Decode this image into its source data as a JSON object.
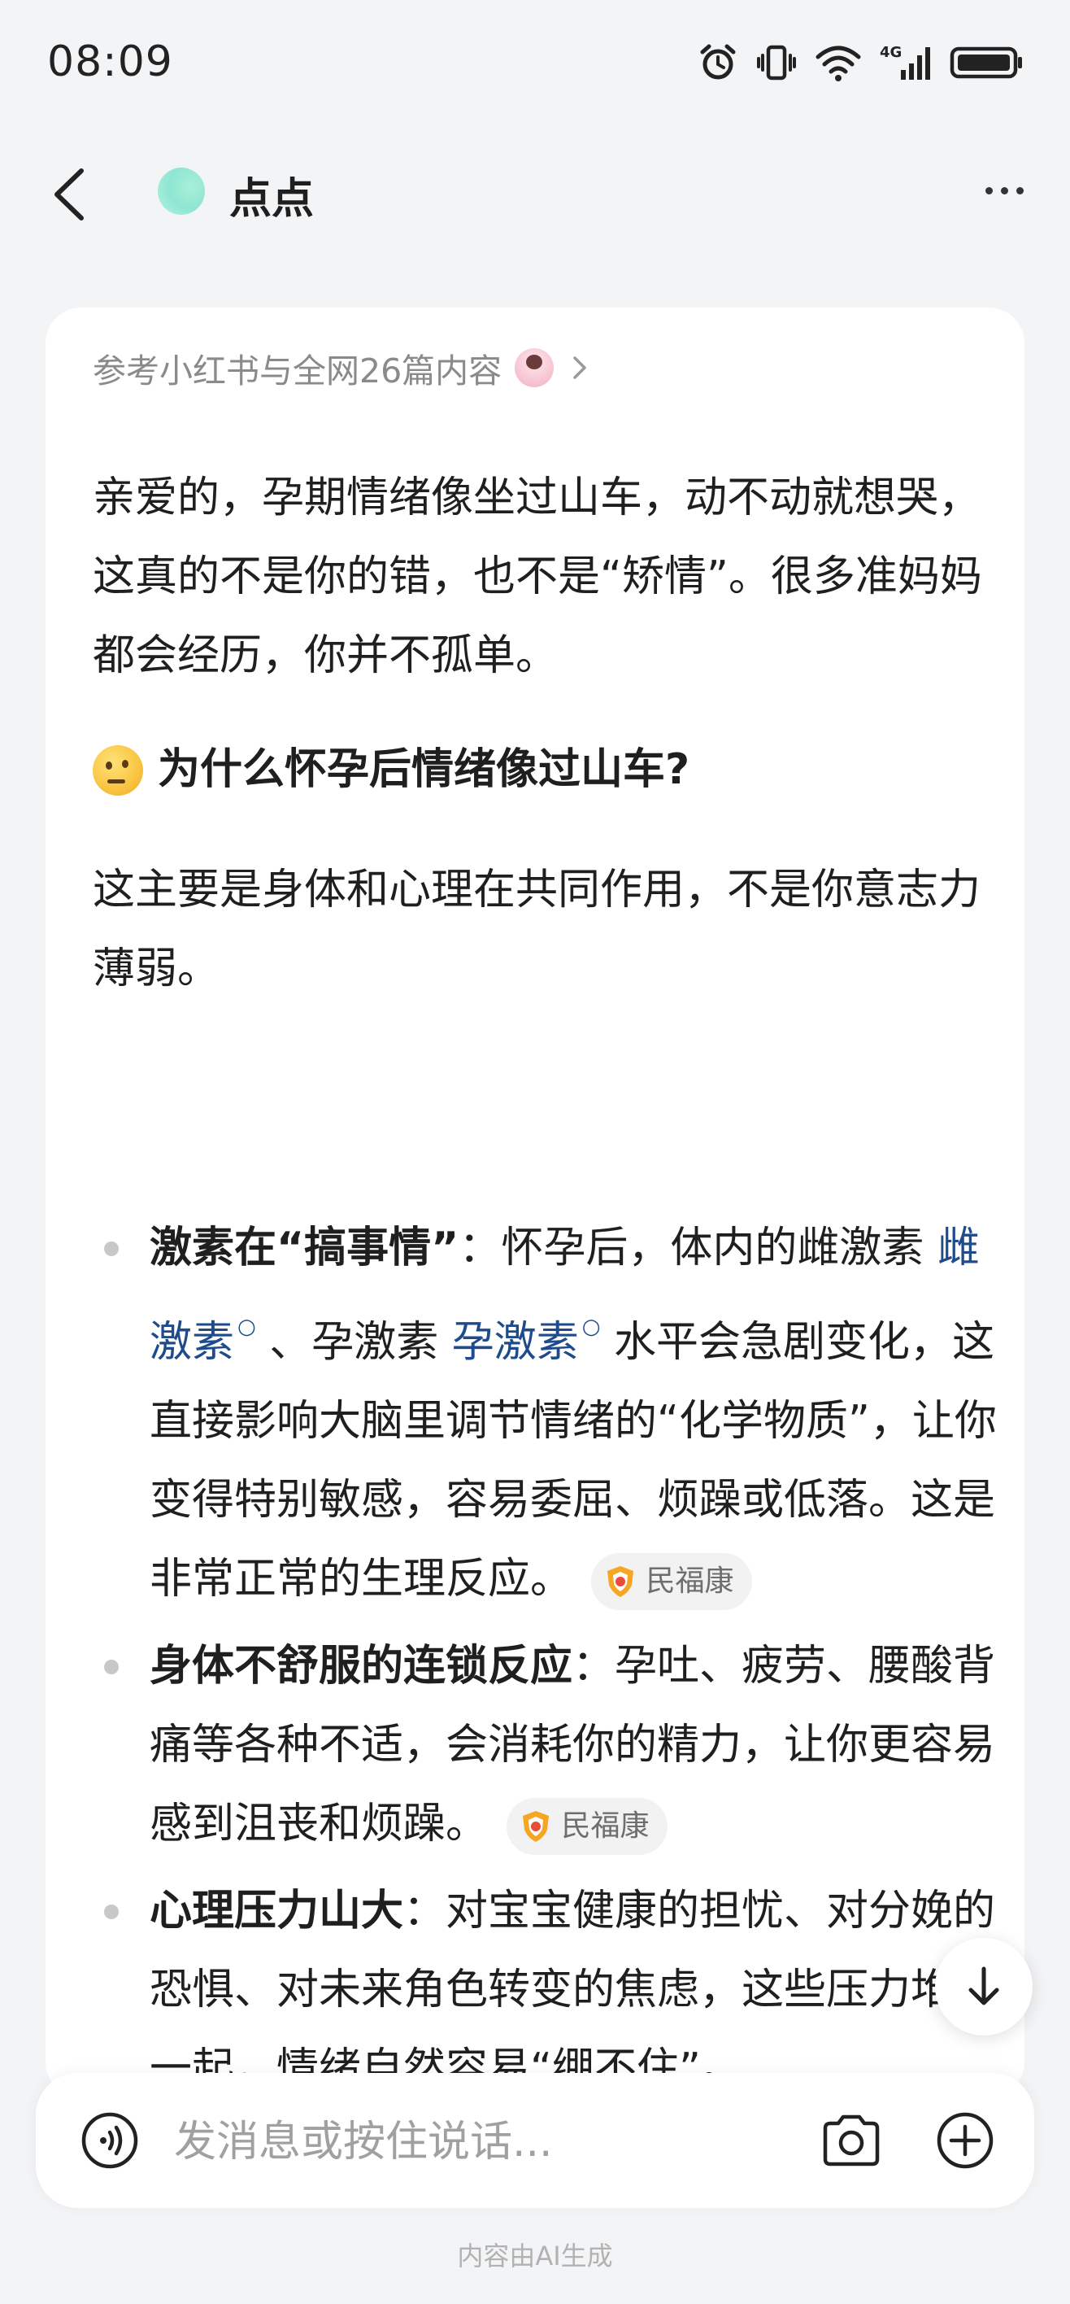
{
  "status_bar": {
    "time": "08:09",
    "icons": [
      "alarm-icon",
      "vibrate-icon",
      "wifi-icon",
      "signal-4g-icon",
      "battery-icon"
    ],
    "network_label": "4G"
  },
  "header": {
    "bot_name": "点点",
    "back_icon": "chevron-left-icon",
    "more_icon": "more-dots-icon",
    "avatar_color": "#8fe6d2"
  },
  "message": {
    "source_label": "参考小红书与全网26篇内容",
    "intro": "亲爱的，孕期情绪像坐过山车，动不动就想哭，这真的不是你的错，也不是“矫情”。很多准妈妈都会经历，你并不孤单。",
    "section_title": "为什么怀孕后情绪像过山车?",
    "section_intro": "这主要是身体和心理在共同作用，不是你意志力薄弱。",
    "bullets": [
      {
        "bold": "激素在“搞事情”",
        "sep": "：",
        "text_a": "怀孕后，体内的雌激素",
        "link_a": "雌激素",
        "text_b": "、孕激素",
        "link_b": "孕激素",
        "text_c": "水平会急剧变化，这直接影响大脑里调节情绪的“化学物质”，让你变得特别敏感，容易委屈、烦躁或低落。这是非常正常的生理反应。",
        "chip": "民福康"
      },
      {
        "bold": "身体不舒服的连锁反应",
        "sep": "：",
        "text": "孕吐、疲劳、腰酸背痛等各种不适，会消耗你的精力，让你更容易感到沮丧和烦躁。",
        "chip": "民福康"
      },
      {
        "bold": "心理压力山大",
        "sep": "：",
        "text": "对宝宝健康的担忧、对分娩的恐惧、对未来角色转变的焦虑，这些压力堆在一起，情绪自然容易“绷不住”。"
      }
    ],
    "link_color": "#1e4b8c"
  },
  "input_bar": {
    "placeholder": "发消息或按住说话...",
    "icons": [
      "voice-icon",
      "camera-icon",
      "plus-circle-icon"
    ]
  },
  "footer_note": "内容由AI生成"
}
